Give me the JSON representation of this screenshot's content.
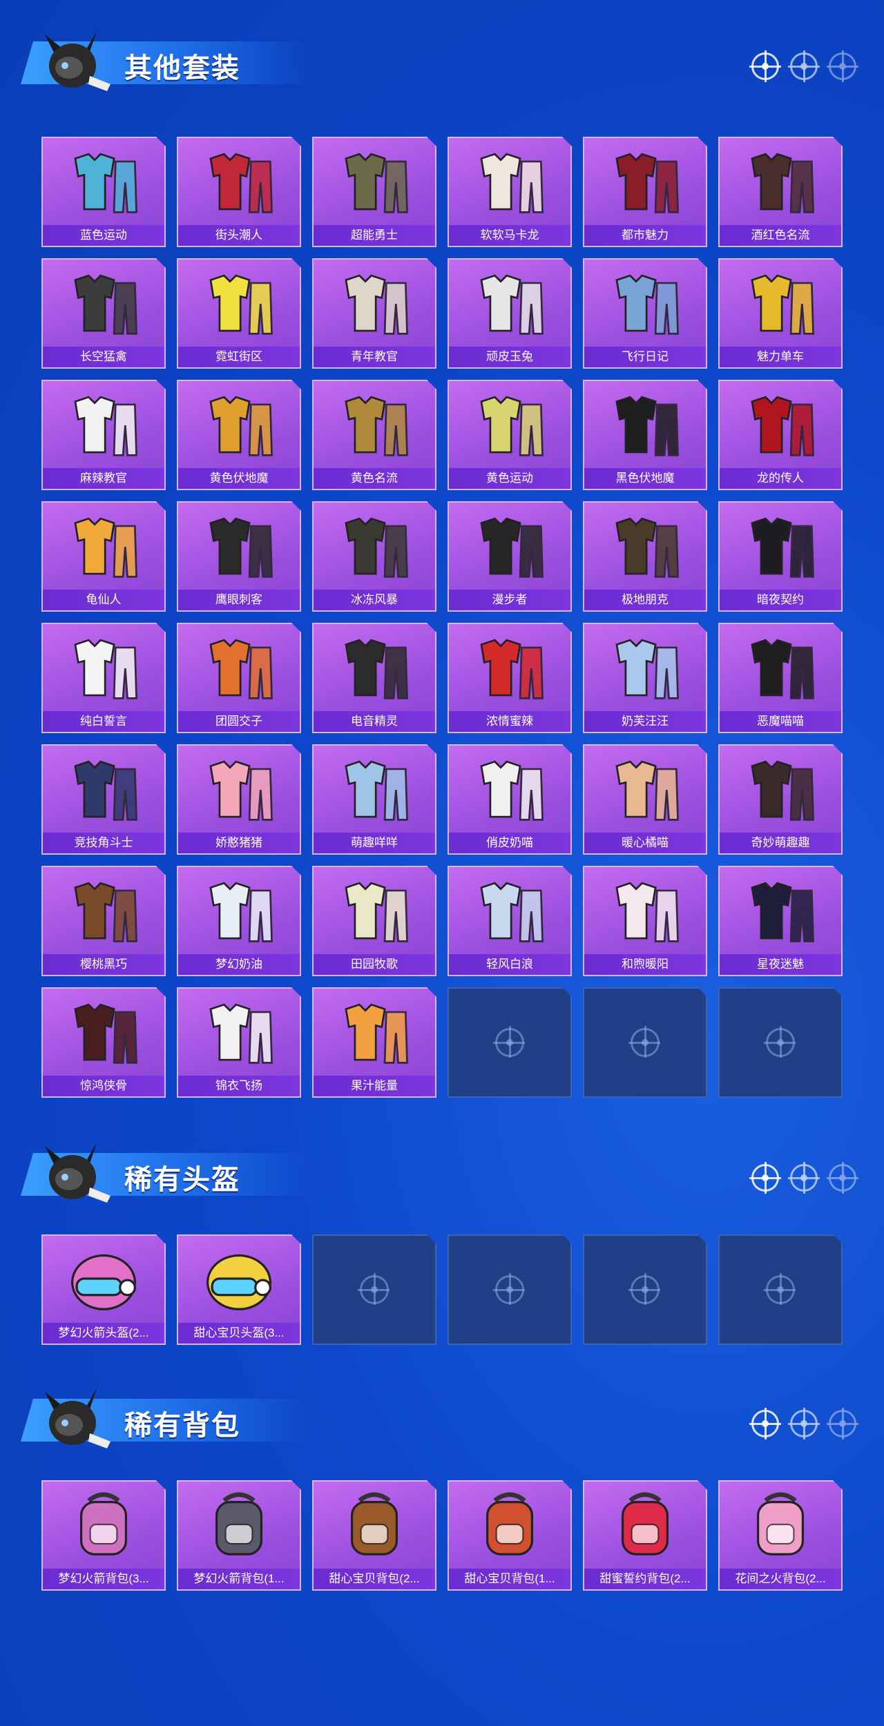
{
  "colors": {
    "background": "#0d47c9",
    "card": "#9b4fdf",
    "card_label": "#6a2bd1",
    "empty_card": "#213f86"
  },
  "sections": [
    {
      "title": "其他套装",
      "items": [
        {
          "label": "蓝色运动",
          "icon": "outfit-icon",
          "color": "#4fb3d8"
        },
        {
          "label": "街头潮人",
          "icon": "outfit-icon",
          "color": "#c0283a"
        },
        {
          "label": "超能勇士",
          "icon": "outfit-icon",
          "color": "#6b6a4a"
        },
        {
          "label": "软软马卡龙",
          "icon": "outfit-icon",
          "color": "#f1e5e0"
        },
        {
          "label": "都市魅力",
          "icon": "outfit-icon",
          "color": "#8a1d2a"
        },
        {
          "label": "酒红色名流",
          "icon": "outfit-icon",
          "color": "#4a2e2e"
        },
        {
          "label": "长空猛禽",
          "icon": "outfit-icon",
          "color": "#3c3c3c"
        },
        {
          "label": "霓虹街区",
          "icon": "outfit-icon",
          "color": "#f0e040"
        },
        {
          "label": "青年教官",
          "icon": "outfit-icon",
          "color": "#ded6c8"
        },
        {
          "label": "顽皮玉兔",
          "icon": "outfit-icon",
          "color": "#e6e6e6"
        },
        {
          "label": "飞行日记",
          "icon": "outfit-icon",
          "color": "#7aa4d6"
        },
        {
          "label": "魅力单车",
          "icon": "outfit-icon",
          "color": "#e7b92c"
        },
        {
          "label": "麻辣教官",
          "icon": "outfit-icon",
          "color": "#f2f2f2"
        },
        {
          "label": "黄色伏地魔",
          "icon": "outfit-icon",
          "color": "#e0a030"
        },
        {
          "label": "黄色名流",
          "icon": "outfit-icon",
          "color": "#b08a3a"
        },
        {
          "label": "黄色运动",
          "icon": "outfit-icon",
          "color": "#d8d470"
        },
        {
          "label": "黑色伏地魔",
          "icon": "outfit-icon",
          "color": "#1e1e1e"
        },
        {
          "label": "龙的传人",
          "icon": "outfit-icon",
          "color": "#b0141e"
        },
        {
          "label": "龟仙人",
          "icon": "outfit-icon",
          "color": "#f2a93b"
        },
        {
          "label": "鹰眼刺客",
          "icon": "outfit-icon",
          "color": "#2a2a2a"
        },
        {
          "label": "冰冻风暴",
          "icon": "outfit-icon",
          "color": "#3a3a32"
        },
        {
          "label": "漫步者",
          "icon": "outfit-icon",
          "color": "#262626"
        },
        {
          "label": "极地朋克",
          "icon": "outfit-icon",
          "color": "#4a3a2a"
        },
        {
          "label": "暗夜契约",
          "icon": "outfit-icon",
          "color": "#1c1c22"
        },
        {
          "label": "纯白誓言",
          "icon": "outfit-icon",
          "color": "#f4f4f4"
        },
        {
          "label": "团圆交子",
          "icon": "outfit-icon",
          "color": "#e2702e"
        },
        {
          "label": "电音精灵",
          "icon": "outfit-icon",
          "color": "#2c2c2c"
        },
        {
          "label": "浓情蜜辣",
          "icon": "outfit-icon",
          "color": "#d42a2a"
        },
        {
          "label": "奶芙汪汪",
          "icon": "outfit-icon",
          "color": "#a9c8ec"
        },
        {
          "label": "恶魔喵喵",
          "icon": "outfit-icon",
          "color": "#1e1e1e"
        },
        {
          "label": "竞技角斗士",
          "icon": "outfit-icon",
          "color": "#2e3a6a"
        },
        {
          "label": "娇憨猪猪",
          "icon": "outfit-icon",
          "color": "#f2a8b8"
        },
        {
          "label": "萌趣咩咩",
          "icon": "outfit-icon",
          "color": "#9ec4e8"
        },
        {
          "label": "俏皮奶喵",
          "icon": "outfit-icon",
          "color": "#f0f0f0"
        },
        {
          "label": "暖心橘喵",
          "icon": "outfit-icon",
          "color": "#e8b890"
        },
        {
          "label": "奇妙萌趣趣",
          "icon": "outfit-icon",
          "color": "#3a2a2a"
        },
        {
          "label": "樱桃黑巧",
          "icon": "outfit-icon",
          "color": "#7a4a2a"
        },
        {
          "label": "梦幻奶油",
          "icon": "outfit-icon",
          "color": "#e8eef8"
        },
        {
          "label": "田园牧歌",
          "icon": "outfit-icon",
          "color": "#eae8c8"
        },
        {
          "label": "轻风白浪",
          "icon": "outfit-icon",
          "color": "#c8d8ee"
        },
        {
          "label": "和煦暖阳",
          "icon": "outfit-icon",
          "color": "#f4e8ee"
        },
        {
          "label": "星夜迷魅",
          "icon": "outfit-icon",
          "color": "#1e1e3a"
        },
        {
          "label": "惊鸿侠骨",
          "icon": "outfit-icon",
          "color": "#4a1e1e"
        },
        {
          "label": "锦衣飞扬",
          "icon": "outfit-icon",
          "color": "#f2f2f2"
        },
        {
          "label": "果汁能量",
          "icon": "outfit-icon",
          "color": "#f2a040"
        }
      ],
      "empty_slots": 3
    },
    {
      "title": "稀有头盔",
      "items": [
        {
          "label": "梦幻火箭头盔(2...",
          "icon": "helmet-icon",
          "color": "#e070c8"
        },
        {
          "label": "甜心宝贝头盔(3...",
          "icon": "helmet-icon",
          "color": "#f2d040"
        }
      ],
      "empty_slots": 4
    },
    {
      "title": "稀有背包",
      "items": [
        {
          "label": "梦幻火箭背包(3...",
          "icon": "backpack-icon",
          "color": "#d070c0"
        },
        {
          "label": "梦幻火箭背包(1...",
          "icon": "backpack-icon",
          "color": "#5a5a6a"
        },
        {
          "label": "甜心宝贝背包(2...",
          "icon": "backpack-icon",
          "color": "#9a5a2a"
        },
        {
          "label": "甜心宝贝背包(1...",
          "icon": "backpack-icon",
          "color": "#d05030"
        },
        {
          "label": "甜蜜誓约背包(2...",
          "icon": "backpack-icon",
          "color": "#e02a4a"
        },
        {
          "label": "花间之火背包(2...",
          "icon": "backpack-icon",
          "color": "#f0a0c8"
        }
      ],
      "empty_slots": 0
    }
  ]
}
